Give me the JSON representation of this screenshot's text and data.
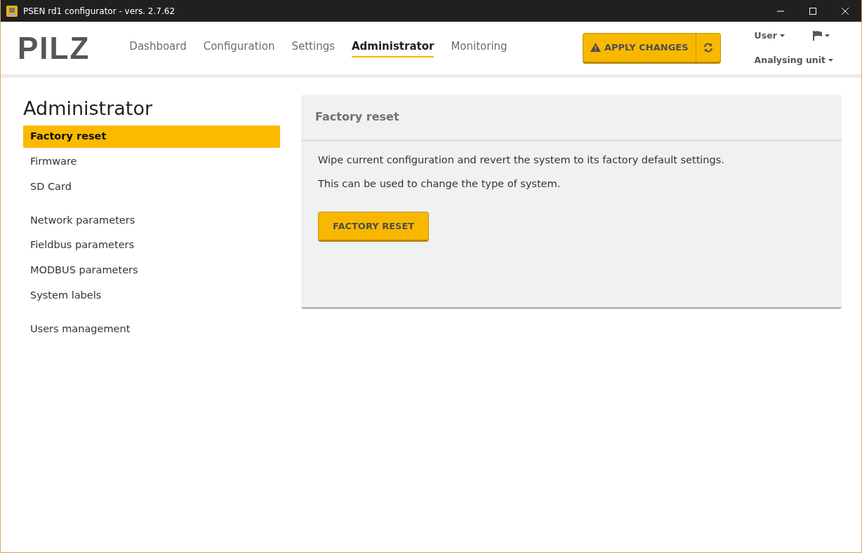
{
  "window": {
    "title": "PSEN rd1 configurator - vers. 2.7.62"
  },
  "header": {
    "logo": "PILZ",
    "nav": [
      {
        "label": "Dashboard",
        "selected": false
      },
      {
        "label": "Configuration",
        "selected": false
      },
      {
        "label": "Settings",
        "selected": false
      },
      {
        "label": "Administrator",
        "selected": true
      },
      {
        "label": "Monitoring",
        "selected": false
      }
    ],
    "apply_button": "APPLY CHANGES",
    "menus": {
      "user": "User",
      "unit": "Analysing unit"
    }
  },
  "sidebar": {
    "title": "Administrator",
    "groups": [
      [
        {
          "label": "Factory reset",
          "selected": true
        },
        {
          "label": "Firmware",
          "selected": false
        },
        {
          "label": "SD Card",
          "selected": false
        }
      ],
      [
        {
          "label": "Network parameters",
          "selected": false
        },
        {
          "label": "Fieldbus parameters",
          "selected": false
        },
        {
          "label": "MODBUS parameters",
          "selected": false
        },
        {
          "label": "System labels",
          "selected": false
        }
      ],
      [
        {
          "label": "Users management",
          "selected": false
        }
      ]
    ]
  },
  "panel": {
    "title": "Factory reset",
    "paragraphs": [
      "Wipe current configuration and revert the system to its factory default settings.",
      "This can be used to change the type of system."
    ],
    "button": "FACTORY RESET"
  }
}
